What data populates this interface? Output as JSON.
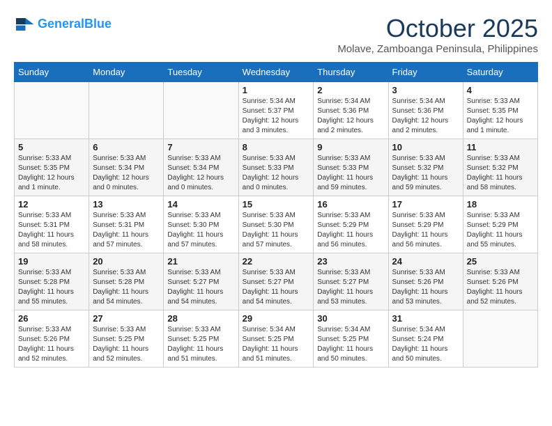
{
  "header": {
    "logo_line1": "General",
    "logo_line2": "Blue",
    "month": "October 2025",
    "location": "Molave, Zamboanga Peninsula, Philippines"
  },
  "weekdays": [
    "Sunday",
    "Monday",
    "Tuesday",
    "Wednesday",
    "Thursday",
    "Friday",
    "Saturday"
  ],
  "weeks": [
    [
      {
        "day": "",
        "info": ""
      },
      {
        "day": "",
        "info": ""
      },
      {
        "day": "",
        "info": ""
      },
      {
        "day": "1",
        "info": "Sunrise: 5:34 AM\nSunset: 5:37 PM\nDaylight: 12 hours\nand 3 minutes."
      },
      {
        "day": "2",
        "info": "Sunrise: 5:34 AM\nSunset: 5:36 PM\nDaylight: 12 hours\nand 2 minutes."
      },
      {
        "day": "3",
        "info": "Sunrise: 5:34 AM\nSunset: 5:36 PM\nDaylight: 12 hours\nand 2 minutes."
      },
      {
        "day": "4",
        "info": "Sunrise: 5:33 AM\nSunset: 5:35 PM\nDaylight: 12 hours\nand 1 minute."
      }
    ],
    [
      {
        "day": "5",
        "info": "Sunrise: 5:33 AM\nSunset: 5:35 PM\nDaylight: 12 hours\nand 1 minute."
      },
      {
        "day": "6",
        "info": "Sunrise: 5:33 AM\nSunset: 5:34 PM\nDaylight: 12 hours\nand 0 minutes."
      },
      {
        "day": "7",
        "info": "Sunrise: 5:33 AM\nSunset: 5:34 PM\nDaylight: 12 hours\nand 0 minutes."
      },
      {
        "day": "8",
        "info": "Sunrise: 5:33 AM\nSunset: 5:33 PM\nDaylight: 12 hours\nand 0 minutes."
      },
      {
        "day": "9",
        "info": "Sunrise: 5:33 AM\nSunset: 5:33 PM\nDaylight: 11 hours\nand 59 minutes."
      },
      {
        "day": "10",
        "info": "Sunrise: 5:33 AM\nSunset: 5:32 PM\nDaylight: 11 hours\nand 59 minutes."
      },
      {
        "day": "11",
        "info": "Sunrise: 5:33 AM\nSunset: 5:32 PM\nDaylight: 11 hours\nand 58 minutes."
      }
    ],
    [
      {
        "day": "12",
        "info": "Sunrise: 5:33 AM\nSunset: 5:31 PM\nDaylight: 11 hours\nand 58 minutes."
      },
      {
        "day": "13",
        "info": "Sunrise: 5:33 AM\nSunset: 5:31 PM\nDaylight: 11 hours\nand 57 minutes."
      },
      {
        "day": "14",
        "info": "Sunrise: 5:33 AM\nSunset: 5:30 PM\nDaylight: 11 hours\nand 57 minutes."
      },
      {
        "day": "15",
        "info": "Sunrise: 5:33 AM\nSunset: 5:30 PM\nDaylight: 11 hours\nand 57 minutes."
      },
      {
        "day": "16",
        "info": "Sunrise: 5:33 AM\nSunset: 5:29 PM\nDaylight: 11 hours\nand 56 minutes."
      },
      {
        "day": "17",
        "info": "Sunrise: 5:33 AM\nSunset: 5:29 PM\nDaylight: 11 hours\nand 56 minutes."
      },
      {
        "day": "18",
        "info": "Sunrise: 5:33 AM\nSunset: 5:29 PM\nDaylight: 11 hours\nand 55 minutes."
      }
    ],
    [
      {
        "day": "19",
        "info": "Sunrise: 5:33 AM\nSunset: 5:28 PM\nDaylight: 11 hours\nand 55 minutes."
      },
      {
        "day": "20",
        "info": "Sunrise: 5:33 AM\nSunset: 5:28 PM\nDaylight: 11 hours\nand 54 minutes."
      },
      {
        "day": "21",
        "info": "Sunrise: 5:33 AM\nSunset: 5:27 PM\nDaylight: 11 hours\nand 54 minutes."
      },
      {
        "day": "22",
        "info": "Sunrise: 5:33 AM\nSunset: 5:27 PM\nDaylight: 11 hours\nand 54 minutes."
      },
      {
        "day": "23",
        "info": "Sunrise: 5:33 AM\nSunset: 5:27 PM\nDaylight: 11 hours\nand 53 minutes."
      },
      {
        "day": "24",
        "info": "Sunrise: 5:33 AM\nSunset: 5:26 PM\nDaylight: 11 hours\nand 53 minutes."
      },
      {
        "day": "25",
        "info": "Sunrise: 5:33 AM\nSunset: 5:26 PM\nDaylight: 11 hours\nand 52 minutes."
      }
    ],
    [
      {
        "day": "26",
        "info": "Sunrise: 5:33 AM\nSunset: 5:26 PM\nDaylight: 11 hours\nand 52 minutes."
      },
      {
        "day": "27",
        "info": "Sunrise: 5:33 AM\nSunset: 5:25 PM\nDaylight: 11 hours\nand 52 minutes."
      },
      {
        "day": "28",
        "info": "Sunrise: 5:33 AM\nSunset: 5:25 PM\nDaylight: 11 hours\nand 51 minutes."
      },
      {
        "day": "29",
        "info": "Sunrise: 5:34 AM\nSunset: 5:25 PM\nDaylight: 11 hours\nand 51 minutes."
      },
      {
        "day": "30",
        "info": "Sunrise: 5:34 AM\nSunset: 5:25 PM\nDaylight: 11 hours\nand 50 minutes."
      },
      {
        "day": "31",
        "info": "Sunrise: 5:34 AM\nSunset: 5:24 PM\nDaylight: 11 hours\nand 50 minutes."
      },
      {
        "day": "",
        "info": ""
      }
    ]
  ]
}
